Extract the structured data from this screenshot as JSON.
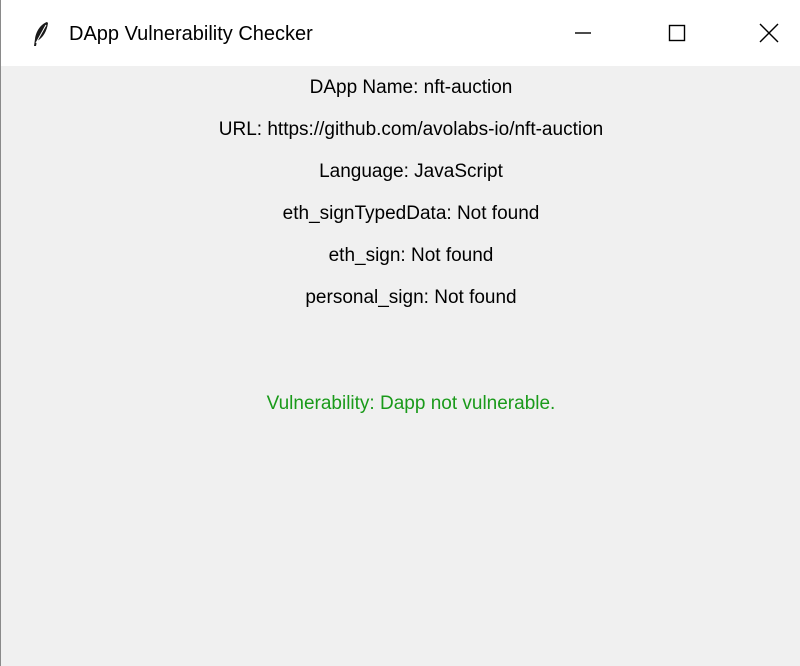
{
  "window": {
    "title": "DApp Vulnerability Checker",
    "icon": "feather-icon",
    "controls": {
      "minimize_icon": "minimize-icon",
      "maximize_icon": "maximize-icon",
      "close_icon": "close-icon"
    }
  },
  "info": {
    "dapp_name": "DApp Name: nft-auction",
    "url": "URL: https://github.com/avolabs-io/nft-auction",
    "language": "Language: JavaScript",
    "eth_signTypedData": "eth_signTypedData: Not found",
    "eth_sign": "eth_sign: Not found",
    "personal_sign": "personal_sign: Not found"
  },
  "result": {
    "text": "Vulnerability: Dapp not vulnerable.",
    "color": "#1a9a1a"
  },
  "colors": {
    "window_bg": "#f0f0f0",
    "titlebar_bg": "#ffffff",
    "text": "#000000"
  }
}
